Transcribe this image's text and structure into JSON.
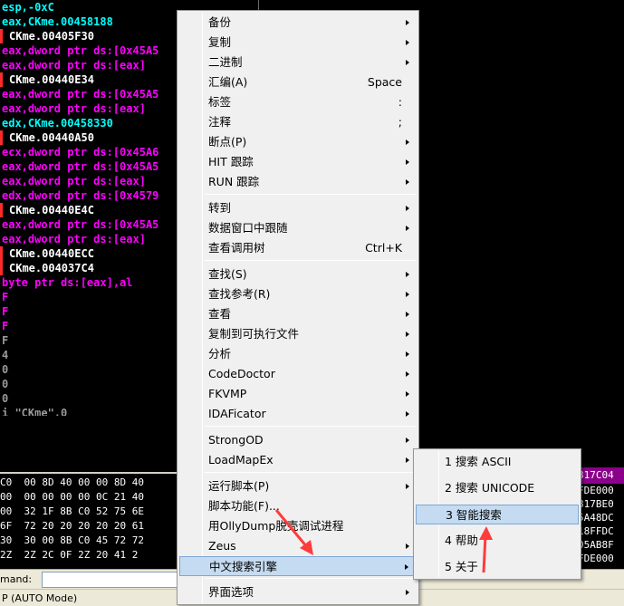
{
  "disasm": {
    "lines": [
      {
        "text": "esp,-0xC",
        "color": "#00ffff",
        "call": false
      },
      {
        "text": "eax,CKme.00458188",
        "color": "#00ffff",
        "call": false
      },
      {
        "text": "CKme.00405F30",
        "color": "#ffffff",
        "call": true
      },
      {
        "text": "eax,dword ptr ds:[0x45A5",
        "color": "#ff00ff",
        "call": false
      },
      {
        "text": "eax,dword ptr ds:[eax]",
        "color": "#ff00ff",
        "call": false
      },
      {
        "text": "CKme.00440E34",
        "color": "#ffffff",
        "call": true
      },
      {
        "text": "eax,dword ptr ds:[0x45A5",
        "color": "#ff00ff",
        "call": false
      },
      {
        "text": "eax,dword ptr ds:[eax]",
        "color": "#ff00ff",
        "call": false
      },
      {
        "text": "edx,CKme.00458330",
        "color": "#00ffff",
        "call": false
      },
      {
        "text": "CKme.00440A50",
        "color": "#ffffff",
        "call": true
      },
      {
        "text": "ecx,dword ptr ds:[0x45A6",
        "color": "#ff00ff",
        "call": false
      },
      {
        "text": "eax,dword ptr ds:[0x45A5",
        "color": "#ff00ff",
        "call": false
      },
      {
        "text": "eax,dword ptr ds:[eax]",
        "color": "#ff00ff",
        "call": false
      },
      {
        "text": "edx,dword ptr ds:[0x4579",
        "color": "#ff00ff",
        "call": false
      },
      {
        "text": "CKme.00440E4C",
        "color": "#ffffff",
        "call": true
      },
      {
        "text": "eax,dword ptr ds:[0x45A5",
        "color": "#ff00ff",
        "call": false
      },
      {
        "text": "eax,dword ptr ds:[eax]",
        "color": "#ff00ff",
        "call": false
      },
      {
        "text": "CKme.00440ECC",
        "color": "#ffffff",
        "call": true
      },
      {
        "text": "CKme.004037C4",
        "color": "#ffffff",
        "call": true
      },
      {
        "text": "byte ptr ds:[eax],al",
        "color": "#ff00ff",
        "call": false
      },
      {
        "text": "F",
        "color": "#ff00ff",
        "call": false
      },
      {
        "text": "F",
        "color": "#ff00ff",
        "call": false
      },
      {
        "text": "F",
        "color": "#ff00ff",
        "call": false
      },
      {
        "text": "F",
        "color": "#9a9a9a",
        "call": false
      },
      {
        "text": "4",
        "color": "#9a9a9a",
        "call": false
      },
      {
        "text": "0",
        "color": "#9a9a9a",
        "call": false
      },
      {
        "text": "0",
        "color": "#9a9a9a",
        "call": false
      },
      {
        "text": "0",
        "color": "#9a9a9a",
        "call": false
      },
      {
        "text": "i \"CKme\",0",
        "color": "#9a9a9a",
        "call": false
      }
    ]
  },
  "hex": {
    "rows": [
      "C0  00 8D 40 00 00 8D 40",
      "00  00 00 00 00 0C 21 40",
      "00  32 1F 8B C0 52 75 6E",
      "6F  72 20 20 20 20 20 61",
      "30  30 00 8B C0 45 72 72",
      "2Z  2Z 2C 0F 2Z 20 41 2"
    ]
  },
  "right_pane": {
    "header": "817C04",
    "rows": [
      "FDE000",
      "817BE0",
      "5A48DC",
      "18FFDC",
      "05AB8F",
      "FDE000"
    ]
  },
  "command": {
    "label": "mand:",
    "value": ""
  },
  "status": {
    "text": "P  (AUTO Mode)"
  },
  "context_menu": {
    "items": [
      {
        "label": "备份",
        "shortcut": "",
        "submenu": true,
        "hl": false
      },
      {
        "label": "复制",
        "shortcut": "",
        "submenu": true,
        "hl": false
      },
      {
        "label": "二进制",
        "shortcut": "",
        "submenu": true,
        "hl": false
      },
      {
        "label": "汇编(A)",
        "shortcut": "Space",
        "submenu": false,
        "hl": false
      },
      {
        "label": "标签",
        "shortcut": ":",
        "submenu": false,
        "hl": false
      },
      {
        "label": "注释",
        "shortcut": ";",
        "submenu": false,
        "hl": false
      },
      {
        "label": "断点(P)",
        "shortcut": "",
        "submenu": true,
        "hl": false
      },
      {
        "label": "HIT 跟踪",
        "shortcut": "",
        "submenu": true,
        "hl": false
      },
      {
        "label": "RUN 跟踪",
        "shortcut": "",
        "submenu": true,
        "hl": false
      },
      {
        "sep": true
      },
      {
        "label": "转到",
        "shortcut": "",
        "submenu": true,
        "hl": false
      },
      {
        "label": "数据窗口中跟随",
        "shortcut": "",
        "submenu": true,
        "hl": false
      },
      {
        "label": "查看调用树",
        "shortcut": "Ctrl+K",
        "submenu": false,
        "hl": false
      },
      {
        "sep": true
      },
      {
        "label": "查找(S)",
        "shortcut": "",
        "submenu": true,
        "hl": false
      },
      {
        "label": "查找参考(R)",
        "shortcut": "",
        "submenu": true,
        "hl": false
      },
      {
        "label": "查看",
        "shortcut": "",
        "submenu": true,
        "hl": false
      },
      {
        "label": "复制到可执行文件",
        "shortcut": "",
        "submenu": true,
        "hl": false
      },
      {
        "label": "分析",
        "shortcut": "",
        "submenu": true,
        "hl": false
      },
      {
        "label": "CodeDoctor",
        "shortcut": "",
        "submenu": true,
        "hl": false
      },
      {
        "label": "FKVMP",
        "shortcut": "",
        "submenu": true,
        "hl": false
      },
      {
        "label": "IDAFicator",
        "shortcut": "",
        "submenu": true,
        "hl": false
      },
      {
        "sep": true
      },
      {
        "label": "StrongOD",
        "shortcut": "",
        "submenu": true,
        "hl": false
      },
      {
        "label": "LoadMapEx",
        "shortcut": "",
        "submenu": true,
        "hl": false
      },
      {
        "sep": true
      },
      {
        "label": "运行脚本(P)",
        "shortcut": "",
        "submenu": true,
        "hl": false
      },
      {
        "label": "脚本功能(F)...",
        "shortcut": "",
        "submenu": false,
        "hl": false
      },
      {
        "label": "用OllyDump脱壳调试进程",
        "shortcut": "",
        "submenu": false,
        "hl": false
      },
      {
        "label": "Zeus",
        "shortcut": "",
        "submenu": true,
        "hl": false
      },
      {
        "label": "中文搜索引擎",
        "shortcut": "",
        "submenu": true,
        "hl": true
      },
      {
        "sep": true
      },
      {
        "label": "界面选项",
        "shortcut": "",
        "submenu": true,
        "hl": false
      }
    ]
  },
  "submenu": {
    "items": [
      {
        "label": "1 搜索 ASCII",
        "hl": false
      },
      {
        "label": "2 搜索 UNICODE",
        "hl": false
      },
      {
        "label": "3 智能搜索",
        "hl": true
      },
      {
        "label": "4 帮助",
        "hl": false
      },
      {
        "label": "5 关于",
        "hl": false
      }
    ]
  },
  "colors": {
    "highlight": "#c5dbf1",
    "arrow": "#ff3b3b",
    "call_marker": "#ff2a2a"
  }
}
